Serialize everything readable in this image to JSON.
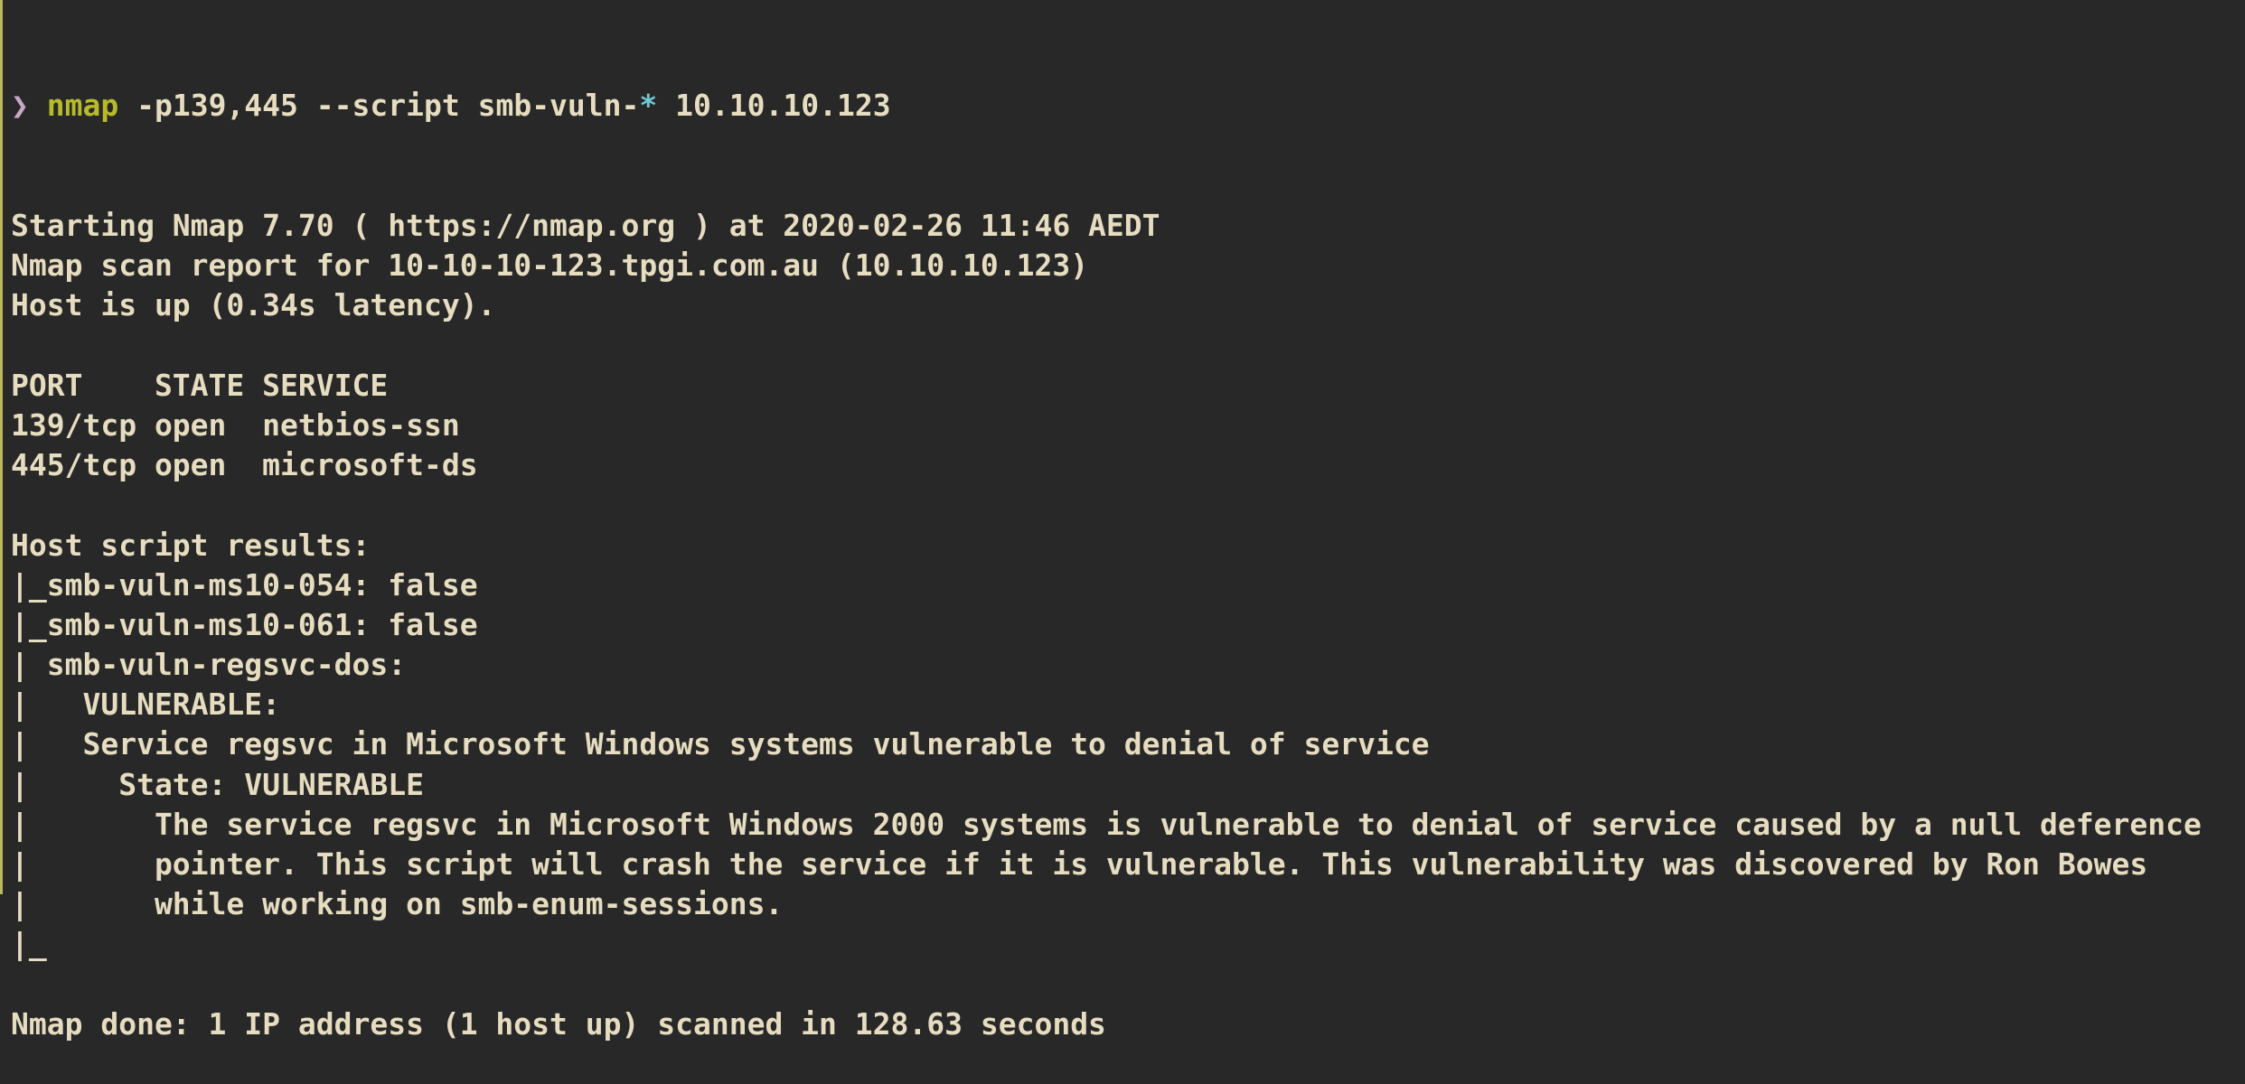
{
  "terminal": {
    "prompt_symbol": "❯",
    "command_name": "nmap",
    "command_args_before_glob": " -p139,445 --script smb-vuln-",
    "command_glob": "*",
    "command_args_after_glob": " 10.10.10.123",
    "output_lines": [
      "Starting Nmap 7.70 ( https://nmap.org ) at 2020-02-26 11:46 AEDT",
      "Nmap scan report for 10-10-10-123.tpgi.com.au (10.10.10.123)",
      "Host is up (0.34s latency).",
      "",
      "PORT    STATE SERVICE",
      "139/tcp open  netbios-ssn",
      "445/tcp open  microsoft-ds",
      "",
      "Host script results:",
      "|_smb-vuln-ms10-054: false",
      "|_smb-vuln-ms10-061: false",
      "| smb-vuln-regsvc-dos:",
      "|   VULNERABLE:",
      "|   Service regsvc in Microsoft Windows systems vulnerable to denial of service",
      "|     State: VULNERABLE",
      "|       The service regsvc in Microsoft Windows 2000 systems is vulnerable to denial of service caused by a null deference",
      "|       pointer. This script will crash the service if it is vulnerable. This vulnerability was discovered by Ron Bowes",
      "|       while working on smb-enum-sessions.",
      "|_",
      "",
      "Nmap done: 1 IP address (1 host up) scanned in 128.63 seconds"
    ]
  },
  "colors": {
    "background": "#282828",
    "text": "#e6dcc0",
    "command": "#b7bb2a",
    "glob": "#6fc9d4",
    "prompt": "#c8a8c8",
    "left_edge": "#bcb75c"
  }
}
